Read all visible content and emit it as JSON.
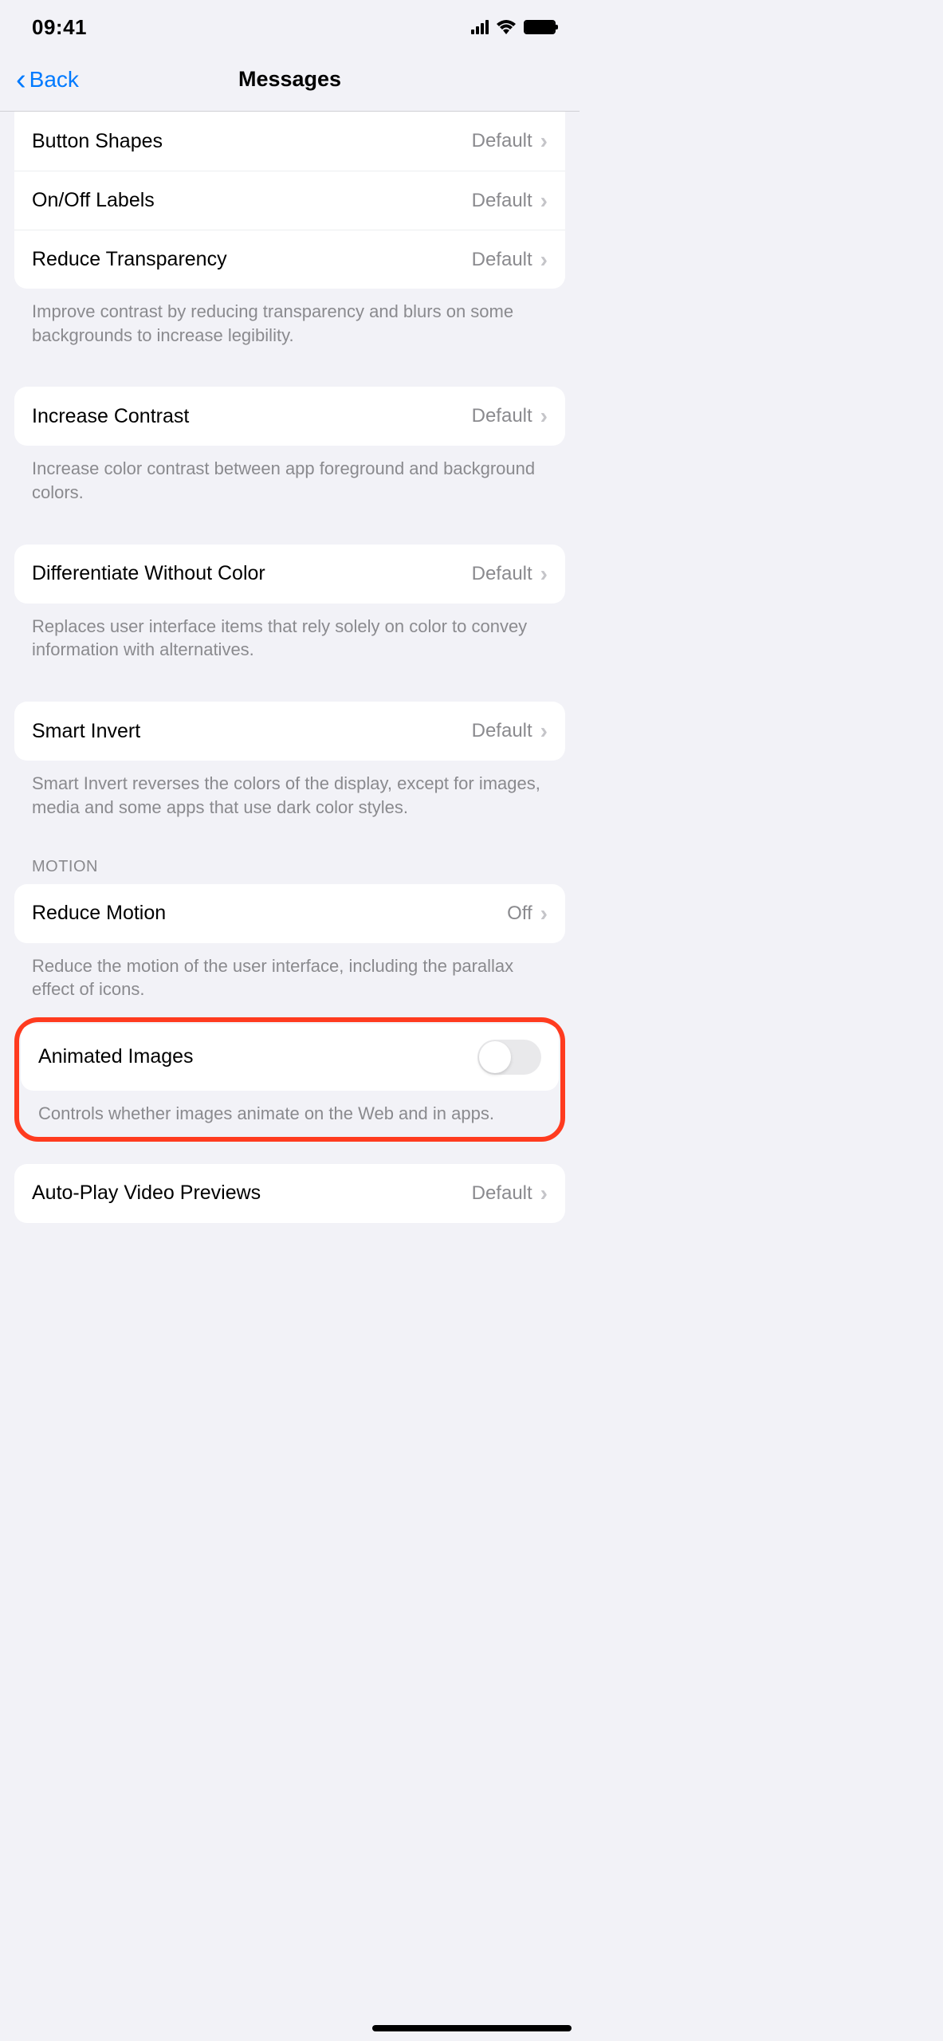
{
  "status": {
    "time": "09:41"
  },
  "nav": {
    "back": "Back",
    "title": "Messages"
  },
  "group1": {
    "rows": [
      {
        "label": "Button Shapes",
        "value": "Default"
      },
      {
        "label": "On/Off Labels",
        "value": "Default"
      },
      {
        "label": "Reduce Transparency",
        "value": "Default"
      }
    ],
    "footer": "Improve contrast by reducing transparency and blurs on some backgrounds to increase legibility."
  },
  "group2": {
    "row": {
      "label": "Increase Contrast",
      "value": "Default"
    },
    "footer": "Increase color contrast between app foreground and background colors."
  },
  "group3": {
    "row": {
      "label": "Differentiate Without Color",
      "value": "Default"
    },
    "footer": "Replaces user interface items that rely solely on color to convey information with alternatives."
  },
  "group4": {
    "row": {
      "label": "Smart Invert",
      "value": "Default"
    },
    "footer": "Smart Invert reverses the colors of the display, except for images, media and some apps that use dark color styles."
  },
  "motion": {
    "header": "MOTION",
    "row": {
      "label": "Reduce Motion",
      "value": "Off"
    },
    "footer": "Reduce the motion of the user interface, including the parallax effect of icons."
  },
  "animated": {
    "row": {
      "label": "Animated Images"
    },
    "footer": "Controls whether images animate on the Web and in apps."
  },
  "autoplay": {
    "row": {
      "label": "Auto-Play Video Previews",
      "value": "Default"
    }
  }
}
